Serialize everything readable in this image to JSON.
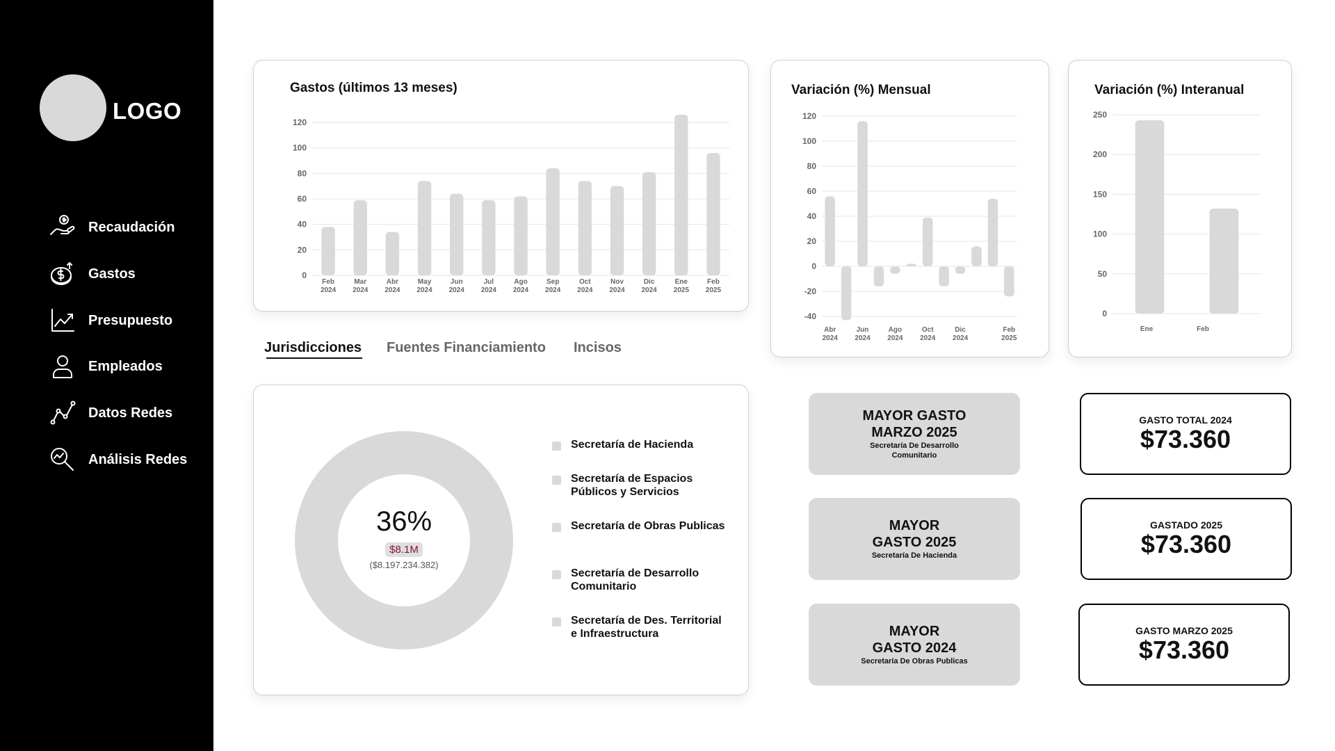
{
  "sidebar": {
    "logo_text": "LOGO",
    "items": [
      {
        "label": "Recaudación",
        "icon": "hand-money-icon"
      },
      {
        "label": "Gastos",
        "icon": "coins-icon"
      },
      {
        "label": "Presupuesto",
        "icon": "trend-chart-icon"
      },
      {
        "label": "Empleados",
        "icon": "user-icon"
      },
      {
        "label": "Datos Redes",
        "icon": "network-line-icon"
      },
      {
        "label": "Análisis Redes",
        "icon": "magnifier-chart-icon"
      }
    ]
  },
  "tabs": [
    {
      "label": "Jurisdicciones",
      "active": true
    },
    {
      "label": "Fuentes Financiamiento",
      "active": false
    },
    {
      "label": "Incisos",
      "active": false
    }
  ],
  "chart_data": [
    {
      "type": "bar",
      "title": "Gastos (últimos 13 meses)",
      "categories": [
        [
          "Feb",
          "2024"
        ],
        [
          "Mar",
          "2024"
        ],
        [
          "Abr",
          "2024"
        ],
        [
          "May",
          "2024"
        ],
        [
          "Jun",
          "2024"
        ],
        [
          "Jul",
          "2024"
        ],
        [
          "Ago",
          "2024"
        ],
        [
          "Sep",
          "2024"
        ],
        [
          "Oct",
          "2024"
        ],
        [
          "Nov",
          "2024"
        ],
        [
          "Dic",
          "2024"
        ],
        [
          "Ene",
          "2025"
        ],
        [
          "Feb",
          "2025"
        ]
      ],
      "values": [
        38,
        59,
        34,
        74,
        64,
        59,
        62,
        84,
        74,
        70,
        81,
        126,
        96
      ],
      "ylim": [
        0,
        120
      ],
      "yticks": [
        0,
        20,
        40,
        60,
        80,
        100,
        120
      ],
      "grid": true
    },
    {
      "type": "bar",
      "title": "Variación (%) Mensual",
      "categories": [
        "Abr 2024",
        "May 2024",
        "Jun 2024",
        "Jul 2024",
        "Ago 2024",
        "Sep 2024",
        "Oct 2024",
        "Nov 2024",
        "Dic 2024",
        "Ene 2025",
        "Feb 2025"
      ],
      "tick_labels": [
        [
          "Abr",
          "2024"
        ],
        [
          "Jun",
          "2024"
        ],
        [
          "Ago",
          "2024"
        ],
        [
          "Oct",
          "2024"
        ],
        [
          "Dic",
          "2024"
        ],
        [
          "Feb",
          "2025"
        ]
      ],
      "tick_indices": [
        0,
        2,
        4,
        6,
        8,
        10
      ],
      "values": [
        56,
        -43,
        116,
        -16,
        -6,
        2,
        39,
        -16,
        -6,
        16,
        54,
        -24
      ],
      "ylim": [
        -40,
        120
      ],
      "yticks": [
        -40,
        -20,
        0,
        20,
        40,
        60,
        80,
        100,
        120
      ],
      "grid": true
    },
    {
      "type": "bar",
      "title": "Variación (%) Interanual",
      "categories": [
        "Ene",
        "Feb"
      ],
      "values": [
        243,
        132
      ],
      "ylim": [
        0,
        250
      ],
      "yticks": [
        0,
        50,
        100,
        150,
        200,
        250
      ],
      "grid": true
    },
    {
      "type": "pie",
      "center_percent": "36%",
      "center_amount": "$8.1M",
      "center_amount_full": "($8.197.234.382)",
      "legend": [
        "Secretaría de Hacienda",
        "Secretaría de Espacios Públicos y Servicios",
        "Secretaría de Obras Publicas",
        "Secretaría de Desarrollo Comunitario",
        "Secretaría de Des. Territorial e Infraestructura"
      ]
    }
  ],
  "highlights": [
    {
      "title": "MAYOR GASTO MARZO 2025",
      "subtitle": "Secretaría De Desarrollo Comunitario"
    },
    {
      "title": "MAYOR GASTO 2025",
      "subtitle": "Secretaría De Hacienda"
    },
    {
      "title": "MAYOR GASTO 2024",
      "subtitle": "Secretaría De Obras Publicas"
    }
  ],
  "kpis": [
    {
      "label": "GASTO TOTAL 2024",
      "value": "$73.360"
    },
    {
      "label": "GASTADO 2025",
      "value": "$73.360"
    },
    {
      "label": "GASTO MARZO 2025",
      "value": "$73.360"
    }
  ],
  "colors": {
    "sidebar_bg": "#000000",
    "bar": "#d9d9d9",
    "amount_text": "#8a1538"
  }
}
